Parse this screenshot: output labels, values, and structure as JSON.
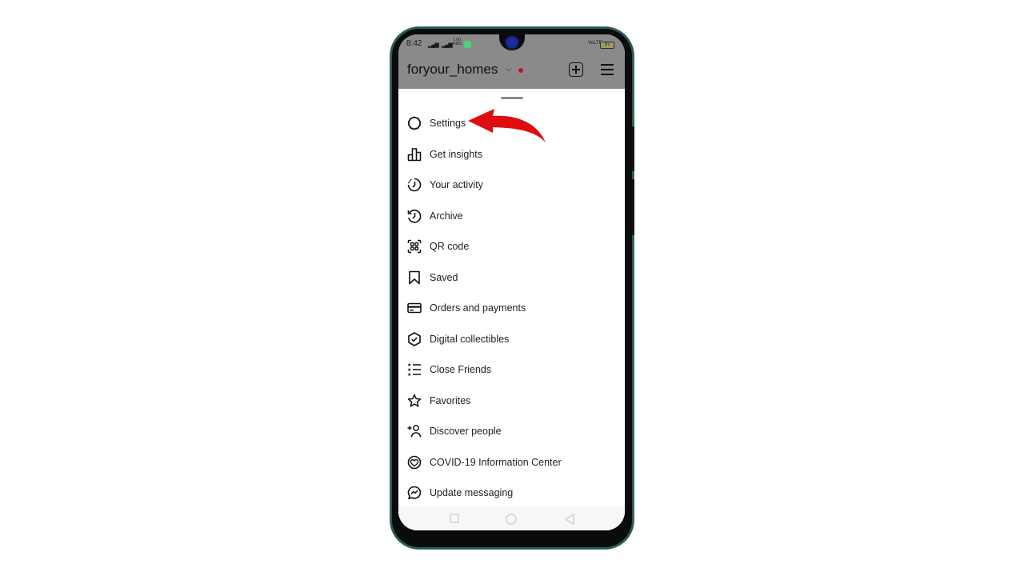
{
  "status_bar": {
    "time": "8:42",
    "signal_1": "4G",
    "net_speed": "7.00 KB/S",
    "volte": "VoLTE",
    "battery": "37"
  },
  "header": {
    "username": "foryour_homes",
    "chevron_icon": "chevron-down-icon",
    "new_post_icon": "plus-square-icon",
    "menu_icon": "hamburger-menu-icon"
  },
  "menu": {
    "items": [
      {
        "label": "Settings",
        "icon": "settings-gear-icon"
      },
      {
        "label": "Get insights",
        "icon": "bar-chart-icon"
      },
      {
        "label": "Your activity",
        "icon": "activity-clock-icon"
      },
      {
        "label": "Archive",
        "icon": "archive-history-icon"
      },
      {
        "label": "QR code",
        "icon": "qr-code-icon"
      },
      {
        "label": "Saved",
        "icon": "bookmark-icon"
      },
      {
        "label": "Orders and payments",
        "icon": "credit-card-icon"
      },
      {
        "label": "Digital collectibles",
        "icon": "hexagon-check-icon"
      },
      {
        "label": "Close Friends",
        "icon": "star-list-icon"
      },
      {
        "label": "Favorites",
        "icon": "star-icon"
      },
      {
        "label": "Discover people",
        "icon": "add-person-icon"
      },
      {
        "label": "COVID-19 Information Center",
        "icon": "heart-circle-icon"
      },
      {
        "label": "Update messaging",
        "icon": "messenger-icon"
      }
    ]
  },
  "nav": {
    "recent_icon": "square-recents-icon",
    "home_icon": "circle-home-icon",
    "back_icon": "triangle-back-icon"
  },
  "annotation": {
    "arrow": "red-arrow-pointing-to-settings",
    "color": "#e00d10"
  }
}
